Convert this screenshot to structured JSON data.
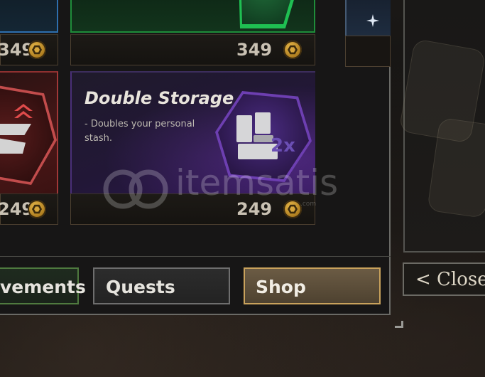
{
  "shop": {
    "top_row": {
      "left_price": "349",
      "middle_price": "349"
    },
    "featured": {
      "title": "Double Storage",
      "description": "- Doubles your personal stash.",
      "multiplier": "2x",
      "price": "249",
      "rarity_color": "#7a4fcf"
    },
    "left_card": {
      "price": "249",
      "rarity_color": "#c24c4c"
    }
  },
  "tabs": [
    {
      "label": "vements",
      "active": false
    },
    {
      "label": "Quests",
      "active": false
    },
    {
      "label": "Shop",
      "active": true
    }
  ],
  "side": {
    "close_label": "< Close"
  },
  "watermark": {
    "brand": "itemsatis",
    "sub": ".com"
  },
  "icons": {
    "currency": "coin-hexagon-icon",
    "featured_item": "storage-crate-icon",
    "left_item": "rank-chevron-icon"
  }
}
